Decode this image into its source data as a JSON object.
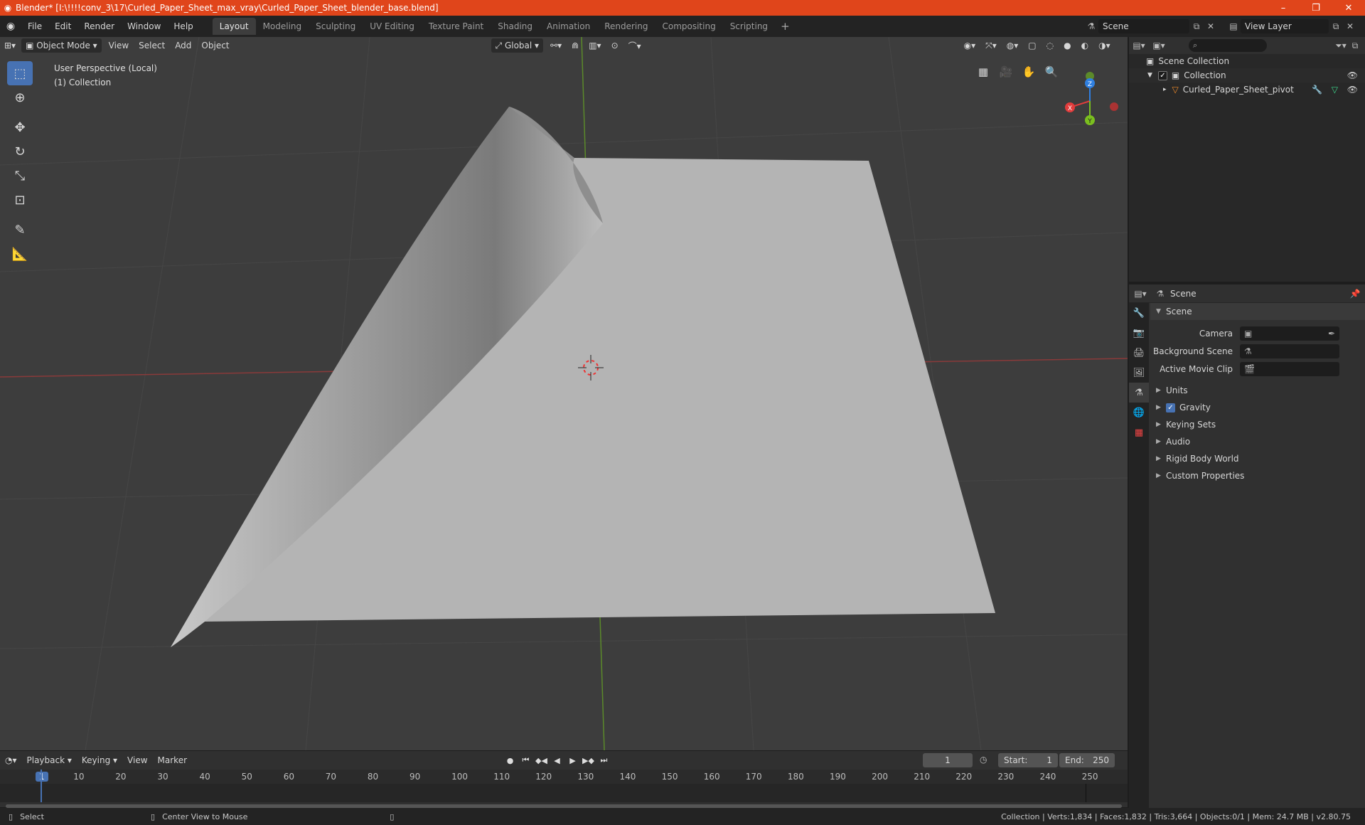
{
  "window": {
    "title": "Blender* [I:\\!!!!conv_3\\17\\Curled_Paper_Sheet_max_vray\\Curled_Paper_Sheet_blender_base.blend]",
    "minimize": "–",
    "maximize": "❐",
    "close": "✕",
    "accent": "#e0451b"
  },
  "menu": {
    "items": [
      "File",
      "Edit",
      "Render",
      "Window",
      "Help"
    ]
  },
  "workspaces": {
    "tabs": [
      "Layout",
      "Modeling",
      "Sculpting",
      "UV Editing",
      "Texture Paint",
      "Shading",
      "Animation",
      "Rendering",
      "Compositing",
      "Scripting"
    ],
    "active": "Layout",
    "add": "+"
  },
  "scene_selector": {
    "value": "Scene"
  },
  "view_layer_selector": {
    "value": "View Layer"
  },
  "viewport": {
    "mode": "Object Mode",
    "menus": [
      "View",
      "Select",
      "Add",
      "Object"
    ],
    "orientation": "Global",
    "info_line1": "User Perspective (Local)",
    "info_line2": "(1) Collection",
    "background": "#3d3d3d",
    "axes": {
      "x": "X",
      "y": "Y",
      "z": "Z"
    }
  },
  "timeline": {
    "menus": [
      "Playback",
      "Keying",
      "View",
      "Marker"
    ],
    "current_frame": "1",
    "start_label": "Start:",
    "start_value": "1",
    "end_label": "End:",
    "end_value": "250",
    "ruler_ticks": [
      "1",
      "10",
      "20",
      "30",
      "40",
      "50",
      "60",
      "70",
      "80",
      "90",
      "100",
      "110",
      "120",
      "130",
      "140",
      "150",
      "160",
      "170",
      "180",
      "190",
      "200",
      "210",
      "220",
      "230",
      "240",
      "250"
    ]
  },
  "statusbar": {
    "left_action": "Select",
    "middle_action": "Center View to Mouse",
    "stats": "Collection | Verts:1,834 | Faces:1,832 | Tris:3,664 | Objects:0/1 | Mem: 24.7 MB | v2.80.75"
  },
  "outliner": {
    "root": "Scene Collection",
    "collection": "Collection",
    "object": "Curled_Paper_Sheet_pivot"
  },
  "properties": {
    "context": "Scene",
    "panel_title": "Scene",
    "rows": [
      {
        "label": "Camera"
      },
      {
        "label": "Background Scene"
      },
      {
        "label": "Active Movie Clip"
      }
    ],
    "subpanels": [
      "Units",
      "Gravity",
      "Keying Sets",
      "Audio",
      "Rigid Body World",
      "Custom Properties"
    ]
  }
}
